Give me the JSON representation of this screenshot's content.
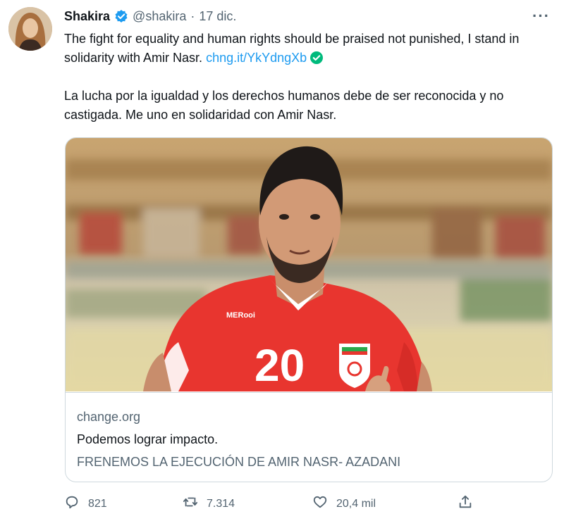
{
  "author": {
    "name": "Shakira",
    "handle": "@shakira",
    "separator": "·",
    "date": "17 dic."
  },
  "tweet": {
    "text_en": "The fight for equality and human rights should be praised not punished, I stand in solidarity with Amir Nasr.",
    "link": "chng.it/YkYdngXb",
    "text_es": "La lucha por la igualdad y los derechos humanos debe de ser reconocida y no castigada. Me uno en solidaridad con Amir Nasr."
  },
  "card": {
    "domain": "change.org",
    "title": "Podemos lograr impacto.",
    "description": "FRENEMOS LA EJECUCIÓN DE AMIR NASR- AZADANI",
    "jersey_number": "20",
    "jersey_brand": "MERooi"
  },
  "actions": {
    "replies": "821",
    "retweets": "7.314",
    "likes": "20,4 mil"
  },
  "icons": {
    "verified": "verified-badge-icon",
    "more": "more-icon",
    "reply": "reply-icon",
    "retweet": "retweet-icon",
    "like": "heart-icon",
    "share": "share-icon"
  },
  "colors": {
    "accent": "#1d9bf0",
    "text": "#0f1419",
    "muted": "#536471",
    "border": "#cfd9de",
    "verified_link_check": "#00ba7c",
    "jersey": "#e8352f"
  }
}
